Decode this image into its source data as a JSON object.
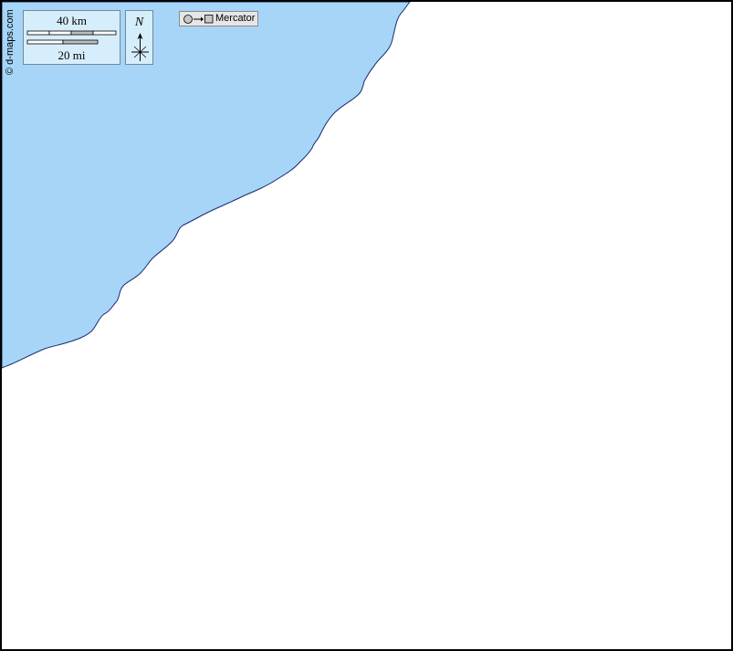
{
  "map": {
    "credit": "© d-maps.com",
    "scale": {
      "km_label": "40 km",
      "mi_label": "20 mi"
    },
    "north_arrow": {
      "label": "N",
      "icon": "compass-rose-icon"
    },
    "projection": {
      "label": "Mercator",
      "icon": "globe-to-flat-projection-icon"
    },
    "colors": {
      "water": "#a6d5f7",
      "land": "#ffffff",
      "coastline": "#1a2a6c",
      "panel_bg": "#d6eefb",
      "border": "#000000"
    }
  }
}
